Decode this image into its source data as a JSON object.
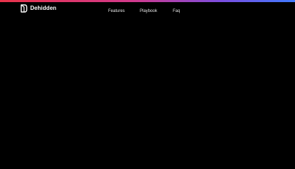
{
  "colors": {
    "background": "#000000",
    "gradient_start": "#e8334a",
    "gradient_mid": "#d23a8c",
    "gradient_end": "#3f7bff",
    "text": "#ffffff"
  },
  "header": {
    "brand": {
      "icon": "dehidden-logo-icon",
      "name": "Dehidden"
    },
    "nav": [
      {
        "label": "Features"
      },
      {
        "label": "Playbook"
      },
      {
        "label": "Faq"
      }
    ]
  }
}
